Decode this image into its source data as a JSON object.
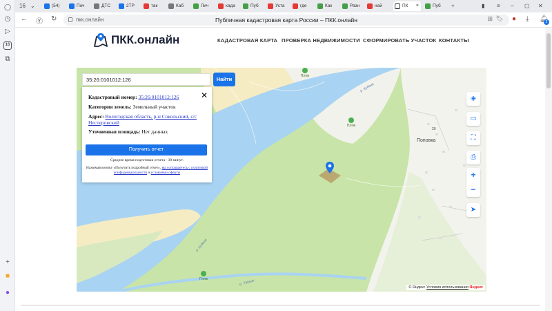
{
  "browser": {
    "tabs": [
      {
        "label": "16",
        "color": "#888"
      },
      {
        "label": "(54)",
        "color": "#1a73e8"
      },
      {
        "label": "Поч",
        "color": "#1a73e8"
      },
      {
        "label": "ДТС",
        "color": "#555"
      },
      {
        "label": "2ТР",
        "color": "#1a73e8"
      },
      {
        "label": "так",
        "color": "#e53935"
      },
      {
        "label": "Каб",
        "color": "#555"
      },
      {
        "label": "Лич",
        "color": "#43a047"
      },
      {
        "label": "када",
        "color": "#e53935"
      },
      {
        "label": "Пуб",
        "color": "#43a047"
      },
      {
        "label": "Уста",
        "color": "#e53935"
      },
      {
        "label": "где",
        "color": "#e53935"
      },
      {
        "label": "Как",
        "color": "#43a047"
      },
      {
        "label": "Разн",
        "color": "#43a047"
      },
      {
        "label": "най",
        "color": "#e53935"
      },
      {
        "label": "ПК",
        "color": "#333"
      },
      {
        "label": "Пуб",
        "color": "#43a047"
      }
    ],
    "url": "пкк.онлайн",
    "page_title": "Публичная кадастровая карта России – ПКК.онлайн",
    "notification_count": "2",
    "rail_badge": "16"
  },
  "site": {
    "logo": "ПКК.онлайн",
    "menu": [
      "КАДАСТРОВАЯ КАРТА",
      "ПРОВЕРКА НЕДВИЖИМОСТИ",
      "СФОРМИРОВАТЬ УЧАСТОК",
      "КОНТАКТЫ"
    ]
  },
  "map": {
    "search_value": "35:26:0101012:126",
    "search_button": "Найти",
    "popup": {
      "cadastral_label": "Кадастровый номер:",
      "cadastral_value": "35:26:0101012:126",
      "category_label": "Категория земель:",
      "category_value": "Земельный участок",
      "address_label": "Адрес:",
      "address_value": "Вологодская область, р-н Сокольский, с/с Нестеровский",
      "area_label": "Уточненная площадь:",
      "area_value": "Нет данных",
      "report_button": "Получить отчет",
      "time_note": "Среднее время подготовки отчета - 30 минут.",
      "consent_text": "Нажимая кнопку «Получить подробный отчет», ",
      "consent_link1": "вы соглашаетесь с политикой конфиденциальности",
      "consent_and": " и ",
      "consent_link2": "условиями оферты"
    },
    "labels": {
      "village": "Поповка",
      "house_number": "20",
      "beach": "Пляж",
      "river": "р. Кубена",
      "river2": "р. Тайник"
    },
    "copyright": {
      "prefix": "© Яндекс",
      "link": "Условия использования",
      "brand": "Яндекс"
    }
  }
}
